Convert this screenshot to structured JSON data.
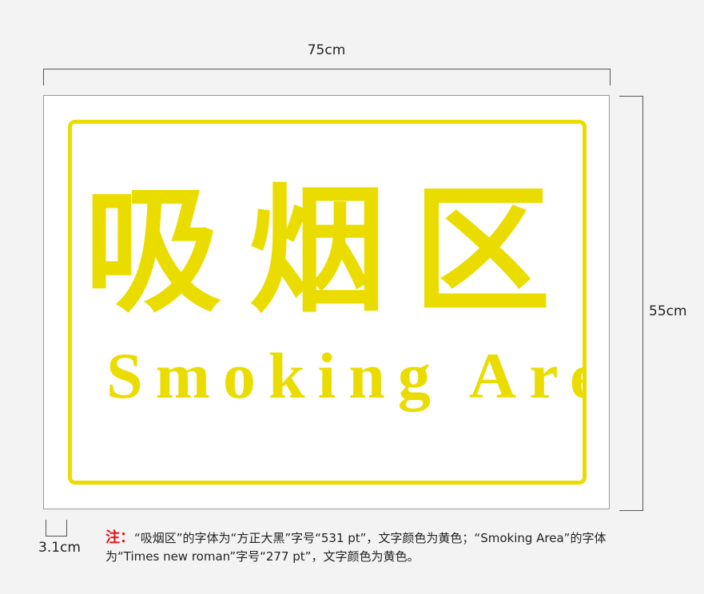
{
  "dimensions": {
    "width": "75cm",
    "height": "55cm",
    "margin": "3.1cm"
  },
  "sign": {
    "title_cn": "吸烟区",
    "title_en": "Smoking Area",
    "color": "#ebdc00"
  },
  "note": {
    "label": "注：",
    "text": "“吸烟区”的字体为“方正大黑”字号“531 pt”，文字颜色为黄色；“Smoking Area”的字体为“Times new roman”字号“277 pt”，文字颜色为黄色。"
  }
}
